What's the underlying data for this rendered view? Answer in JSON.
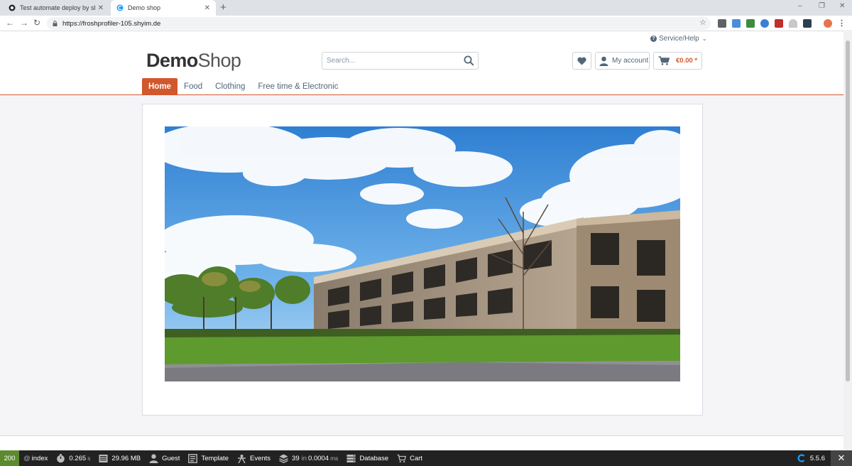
{
  "browser": {
    "tabs": [
      {
        "title": "Test automate deploy by shyim · ",
        "close": "✕"
      },
      {
        "title": "Demo shop",
        "close": "✕"
      }
    ],
    "new_tab": "+",
    "url": "https://froshprofiler-105.shyim.de"
  },
  "header": {
    "service_label": "Service/Help",
    "logo_bold": "Demo",
    "logo_light": "Shop",
    "search_placeholder": "Search...",
    "account_label": "My account",
    "cart_total": "€0.00 *"
  },
  "nav": {
    "items": [
      "Home",
      "Food",
      "Clothing",
      "Free time & Electronic"
    ],
    "active": "Home"
  },
  "profiler": {
    "status_code": "200",
    "route": "index",
    "time_value": "0.265",
    "time_unit": "s",
    "memory": "29.96 MB",
    "user": "Guest",
    "template_label": "Template",
    "events_label": "Events",
    "db_count": "39",
    "db_in": "in",
    "db_time": "0.0004",
    "db_unit": "ms",
    "database_label": "Database",
    "cart_label": "Cart",
    "version": "5.5.6"
  },
  "colors": {
    "accent": "#d1572c",
    "profiler_bg": "#222222",
    "status_ok": "#5c8a2e"
  }
}
